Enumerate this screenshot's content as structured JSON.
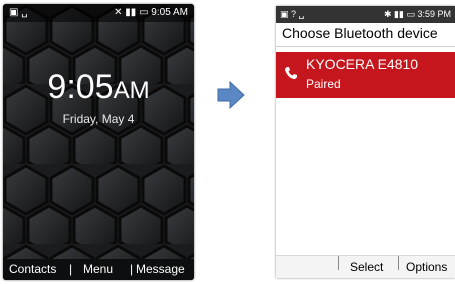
{
  "left_screen": {
    "status_time": "9:05 AM",
    "clock_time": "9:05",
    "clock_ampm": "AM",
    "date": "Friday, May 4",
    "softkeys": [
      "Contacts",
      "Menu",
      "Message"
    ]
  },
  "right_screen": {
    "status_time": "3:59 PM",
    "title": "Choose Bluetooth device",
    "device": {
      "name": "KYOCERA E4810",
      "status": "Paired"
    },
    "softkeys": [
      "Select",
      "Options"
    ]
  },
  "colors": {
    "accent": "#c4161c",
    "arrow": "#5b87c5"
  }
}
